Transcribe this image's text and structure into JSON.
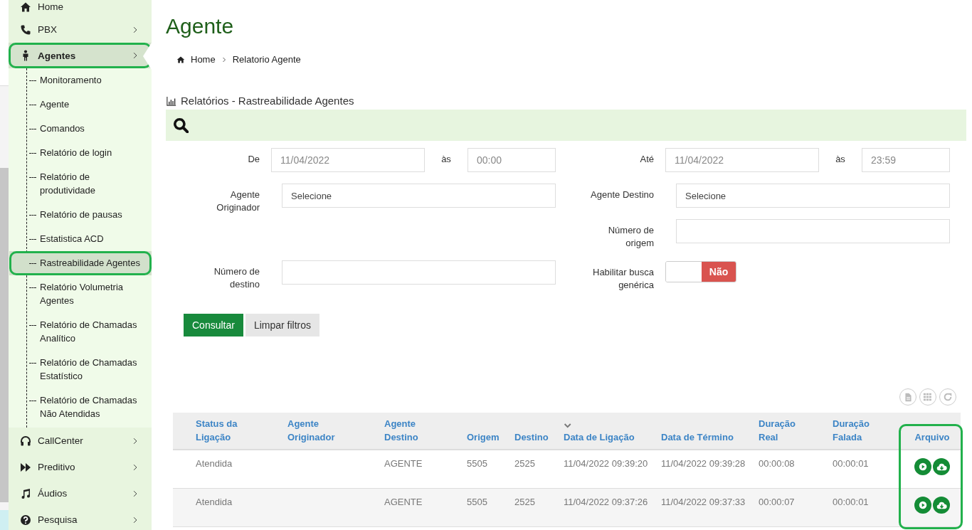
{
  "sidebar": {
    "items": [
      {
        "label": "Home",
        "selected": false,
        "highlighted": false,
        "has_submenu": false
      },
      {
        "label": "PBX",
        "selected": false,
        "highlighted": false,
        "has_submenu": true
      },
      {
        "label": "Agentes",
        "selected": true,
        "highlighted": true,
        "has_submenu": true,
        "children": [
          {
            "label": "Monitoramento",
            "selected": false,
            "highlighted": false
          },
          {
            "label": "Agente",
            "selected": false,
            "highlighted": false
          },
          {
            "label": "Comandos",
            "selected": false,
            "highlighted": false
          },
          {
            "label": "Relatório de login",
            "selected": false,
            "highlighted": false
          },
          {
            "label": "Relatório de produtividade",
            "selected": false,
            "highlighted": false
          },
          {
            "label": "Relatório de pausas",
            "selected": false,
            "highlighted": false
          },
          {
            "label": "Estatistica ACD",
            "selected": false,
            "highlighted": false
          },
          {
            "label": "Rastreabilidade Agentes",
            "selected": true,
            "highlighted": true
          },
          {
            "label": "Relatório Volumetria Agentes",
            "selected": false,
            "highlighted": false
          },
          {
            "label": "Relatório de Chamadas Analítico",
            "selected": false,
            "highlighted": false
          },
          {
            "label": "Relatório de Chamadas Estatístico",
            "selected": false,
            "highlighted": false
          },
          {
            "label": "Relatório de Chamadas Não Atendidas",
            "selected": false,
            "highlighted": false
          }
        ]
      },
      {
        "label": "CallCenter",
        "selected": false,
        "highlighted": false,
        "has_submenu": true
      },
      {
        "label": "Preditivo",
        "selected": false,
        "highlighted": false,
        "has_submenu": true
      },
      {
        "label": "Áudios",
        "selected": false,
        "highlighted": false,
        "has_submenu": true
      },
      {
        "label": "Pesquisa",
        "selected": false,
        "highlighted": false,
        "has_submenu": true
      }
    ]
  },
  "page_title": "Agente",
  "breadcrumb": [
    "Home",
    "Relatorio Agente"
  ],
  "section_title": "Relatórios - Rastreabilidade Agentes",
  "filters": {
    "from": {
      "label": "De",
      "date": "11/04/2022",
      "at_label": "às",
      "time": "00:00"
    },
    "to": {
      "label": "Até",
      "date": "11/04/2022",
      "at_label": "às",
      "time": "23:59"
    },
    "origin_agent": {
      "label": "Agente Originador",
      "value": "Selecione"
    },
    "destination_agent": {
      "label": "Agente Destino",
      "value": "Selecione"
    },
    "origin_number": {
      "label": "Número de origem"
    },
    "destination_number": {
      "label": "Número de destino"
    },
    "generic_search": {
      "label": "Habilitar busca genérica",
      "toggle_label": "Não",
      "on": false
    }
  },
  "buttons": [
    "Consultar",
    "Limpar filtros"
  ],
  "table": {
    "columns": [
      {
        "label": "Status da Ligação",
        "sorted": false
      },
      {
        "label": "Agente Originador",
        "sorted": false
      },
      {
        "label": "Agente Destino",
        "sorted": false
      },
      {
        "label": "Origem",
        "sorted": false
      },
      {
        "label": "Destino",
        "sorted": false
      },
      {
        "label": "Data de Ligação",
        "sorted": true
      },
      {
        "label": "Data de Término",
        "sorted": false
      },
      {
        "label": "Duração Real",
        "sorted": false
      },
      {
        "label": "Duração Falada",
        "sorted": false
      },
      {
        "label": "Arquivo",
        "sorted": false,
        "highlighted": true
      }
    ],
    "rows": [
      [
        "Atendida",
        "",
        "AGENTE",
        "5505",
        "2525",
        "11/04/2022 09:39:20",
        "11/04/2022 09:39:28",
        "00:00:08",
        "00:00:01"
      ],
      [
        "Atendida",
        "",
        "AGENTE",
        "5505",
        "2525",
        "11/04/2022 09:37:26",
        "11/04/2022 09:37:33",
        "00:00:07",
        "00:00:01"
      ]
    ]
  }
}
